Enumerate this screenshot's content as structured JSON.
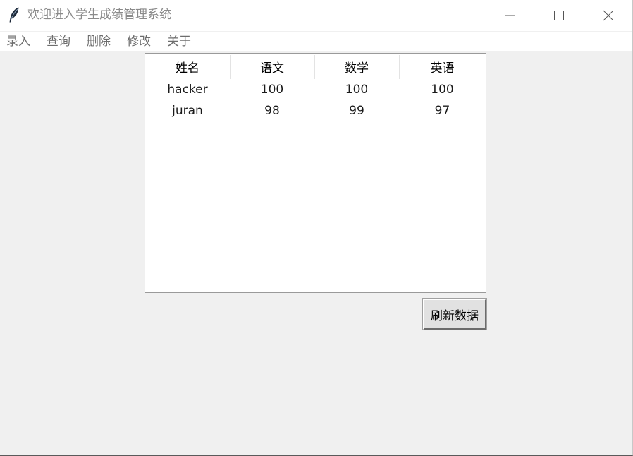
{
  "window": {
    "title": "欢迎进入学生成绩管理系统",
    "icon": "feather-icon"
  },
  "menubar": {
    "items": [
      {
        "label": "录入"
      },
      {
        "label": "查询"
      },
      {
        "label": "删除"
      },
      {
        "label": "修改"
      },
      {
        "label": "关于"
      }
    ]
  },
  "table": {
    "columns": [
      "姓名",
      "语文",
      "数学",
      "英语"
    ],
    "rows": [
      [
        "hacker",
        "100",
        "100",
        "100"
      ],
      [
        "juran",
        "98",
        "99",
        "97"
      ]
    ]
  },
  "actions": {
    "refresh_label": "刷新数据"
  }
}
